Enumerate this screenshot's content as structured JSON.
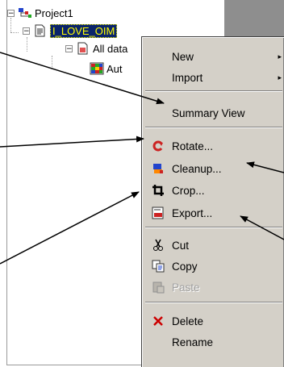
{
  "tree": {
    "root_label": "Project1",
    "selected_label": "I_LOVE_OIM",
    "child_label": "All data",
    "grandchild_label": "Aut",
    "expander_symbol": "−"
  },
  "menu": {
    "new": "New",
    "import": "Import",
    "summary_view": "Summary View",
    "rotate": "Rotate...",
    "cleanup": "Cleanup...",
    "crop": "Crop...",
    "export": "Export...",
    "cut": "Cut",
    "copy": "Copy",
    "paste": "Paste",
    "delete": "Delete",
    "rename": "Rename",
    "submenu_arrow": "▸"
  },
  "colors": {
    "menu_bg": "#d4d0c8",
    "selection_bg": "#0a246a",
    "selection_text": "#ffff00",
    "rotate_icon": "#cc2222",
    "delete_icon": "#cc0000"
  }
}
